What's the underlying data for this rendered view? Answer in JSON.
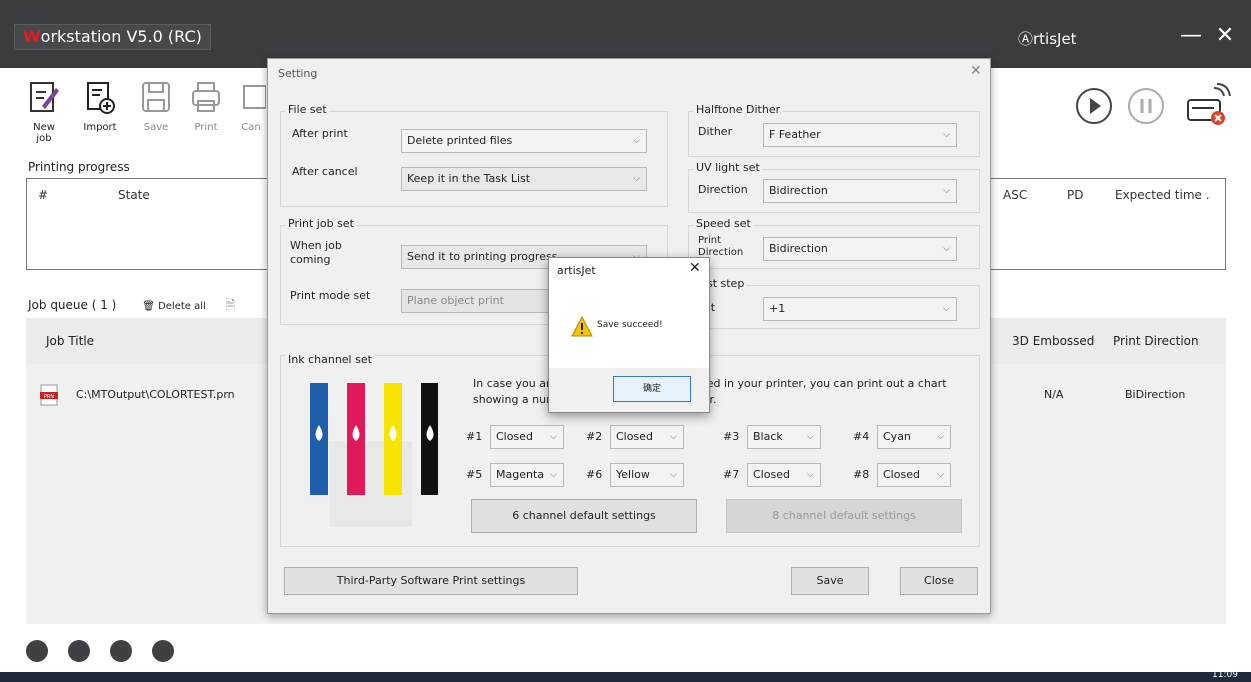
{
  "window": {
    "title_rest": "orkstation V5.0 (RC)",
    "title_first": "W",
    "brand": "ⒶrtisJet",
    "minimize": "—",
    "close": "✕"
  },
  "toolbar": {
    "new_job": "New job",
    "import": "Import",
    "save": "Save",
    "print": "Print",
    "cancel": "Can"
  },
  "printing": {
    "label": "Printing progress",
    "columns": [
      "#",
      "State",
      "ASC",
      "PD",
      "Expected time  ."
    ]
  },
  "job_queue": {
    "label": "Job queue ( 1 )",
    "delete_all": "Delete all",
    "columns": [
      "Job Title",
      "3D Embossed",
      "Print Direction"
    ],
    "rows": [
      {
        "title": "C:\\MTOutput\\COLORTEST.prn",
        "badge": "PRN",
        "embossed": "N/A",
        "direction": "BiDirection"
      }
    ]
  },
  "setting": {
    "title": "Setting",
    "file_set": {
      "label": "File set",
      "after_print_label": "After print",
      "after_print": "Delete printed files",
      "after_cancel_label": "After cancel",
      "after_cancel": "Keep it in the Task List"
    },
    "halftone": {
      "label": "Halftone Dither",
      "dither_label": "Dither",
      "dither": "F Feather"
    },
    "uv": {
      "label": "UV light set",
      "direction_label": "Direction",
      "direction": "Bidirection"
    },
    "print_job": {
      "label": "Print job set",
      "when_label": "When job\ncoming",
      "when": "Send it to printing progress",
      "mode_label": "Print mode set",
      "mode": "Plane object print"
    },
    "speed": {
      "label": "Speed set",
      "dir_label": "Print\nDirection",
      "dir": "Bidirection"
    },
    "adjust": {
      "label": "ust step",
      "adj_label": "ust",
      "adj": "+1"
    },
    "ink": {
      "label": "Ink channel set",
      "text_a": "In case you ar",
      "text_b": "aded in your printer, you can print out a chart",
      "text_c": "showing a nur",
      "text_d": "olor.",
      "channels": [
        {
          "num": "#1",
          "value": "Closed"
        },
        {
          "num": "#2",
          "value": "Closed"
        },
        {
          "num": "#3",
          "value": "Black"
        },
        {
          "num": "#4",
          "value": "Cyan"
        },
        {
          "num": "#5",
          "value": "Magenta"
        },
        {
          "num": "#6",
          "value": "Yellow"
        },
        {
          "num": "#7",
          "value": "Closed"
        },
        {
          "num": "#8",
          "value": "Closed"
        }
      ],
      "btn6": "6 channel default settings",
      "btn8": "8 channel default settings",
      "ink_colors": [
        "#1f5eaa",
        "#e01a58",
        "#f6e500",
        "#111111"
      ]
    },
    "third_party": "Third-Party Software Print settings",
    "save": "Save",
    "close": "Close"
  },
  "msgbox": {
    "title": "artisJet",
    "text": "Save succeed!",
    "ok": "确定"
  },
  "clock": "11:09"
}
